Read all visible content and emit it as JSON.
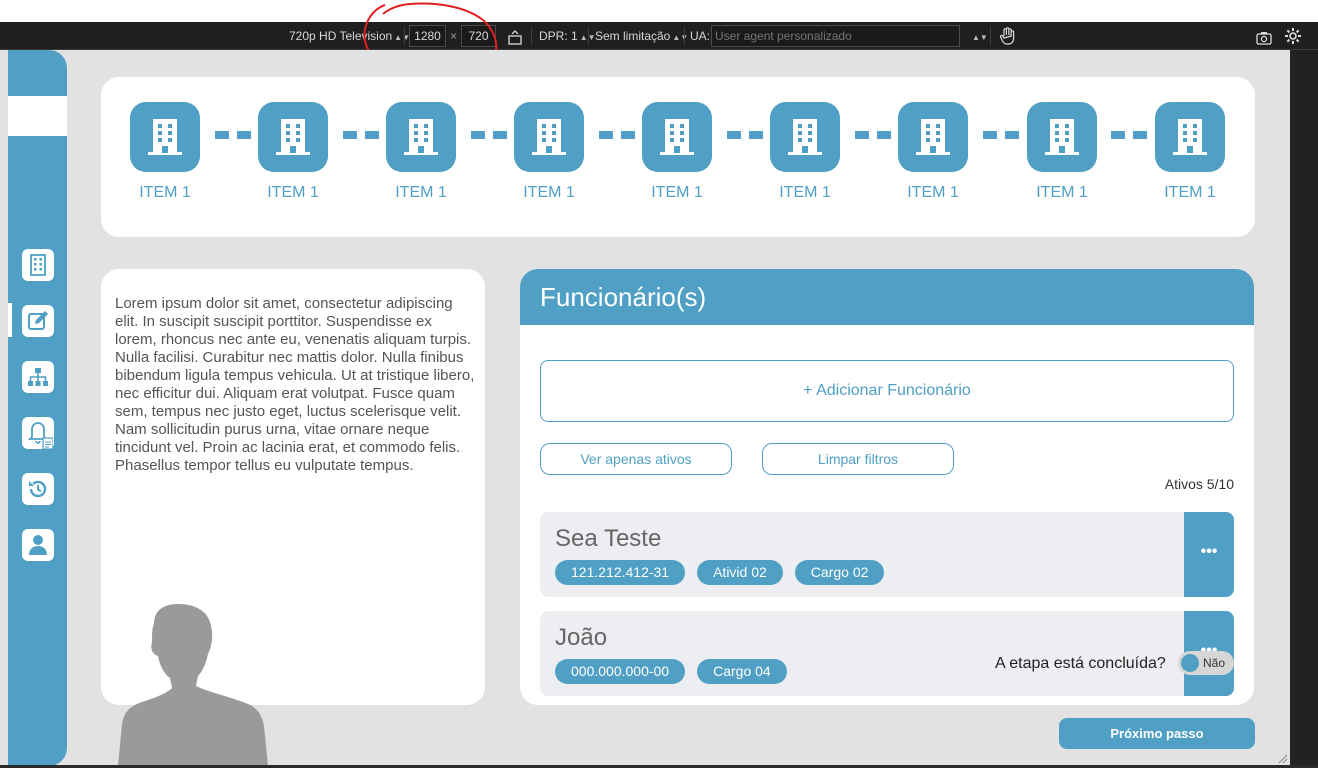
{
  "devtools": {
    "device": "720p HD Television",
    "width": "1280",
    "times": "×",
    "height": "720",
    "dpr": "DPR: 1",
    "throttle": "Sem limitação",
    "ua_label": "UA:",
    "ua_placeholder": "User agent personalizado"
  },
  "sidebar": {
    "items": [
      {
        "icon": "building-icon"
      },
      {
        "icon": "edit-icon",
        "active": true
      },
      {
        "icon": "hierarchy-icon"
      },
      {
        "icon": "bell-document-icon"
      },
      {
        "icon": "history-icon"
      },
      {
        "icon": "user-icon"
      }
    ]
  },
  "steps": [
    {
      "label": "ITEM 1"
    },
    {
      "label": "ITEM 1"
    },
    {
      "label": "ITEM 1"
    },
    {
      "label": "ITEM 1"
    },
    {
      "label": "ITEM 1"
    },
    {
      "label": "ITEM 1"
    },
    {
      "label": "ITEM 1"
    },
    {
      "label": "ITEM 1"
    },
    {
      "label": "ITEM 1"
    }
  ],
  "info": {
    "text": "Lorem ipsum dolor sit amet, consectetur adipiscing elit. In suscipit suscipit porttitor. Suspendisse ex lorem, rhoncus nec ante eu, venenatis aliquam turpis. Nulla facilisi. Curabitur nec mattis dolor. Nulla finibus bibendum ligula tempus vehicula. Ut at tristique libero, nec efficitur dui. Aliquam erat volutpat. Fusce quam sem, tempus nec justo eget, luctus scelerisque velit. Nam sollicitudin purus urna, vitae ornare neque tincidunt vel. Proin ac lacinia erat, et commodo felis. Phasellus tempor tellus eu vulputate tempus."
  },
  "funcionarios": {
    "title": "Funcionário(s)",
    "add_label": "+ Adicionar Funcionário",
    "filter_active": "Ver apenas ativos",
    "filter_clear": "Limpar filtros",
    "ativos": "Ativos 5/10",
    "more": "•••",
    "employees": [
      {
        "name": "Sea Teste",
        "tags": [
          "121.212.412-31",
          "Ativid 02",
          "Cargo 02"
        ]
      },
      {
        "name": "João",
        "tags": [
          "000.000.000-00",
          "Cargo 04"
        ]
      }
    ]
  },
  "footer": {
    "question": "A etapa está concluída?",
    "toggle_label": "Não",
    "next_label": "Próximo passo"
  },
  "colors": {
    "accent": "#4fa0c4",
    "background": "#e2e2e2",
    "annotation": "#e02020"
  }
}
